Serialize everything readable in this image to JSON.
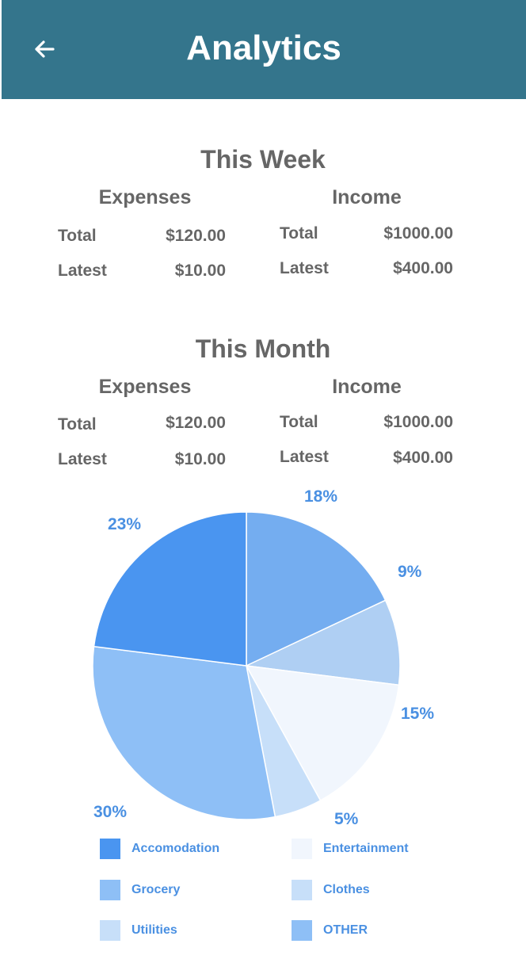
{
  "header": {
    "title": "Analytics",
    "back_icon": "arrow-left-icon"
  },
  "week": {
    "title": "This Week",
    "expenses": {
      "heading": "Expenses",
      "total_label": "Total",
      "total_value": "$120.00",
      "latest_label": "Latest",
      "latest_value": "$10.00"
    },
    "income": {
      "heading": "Income",
      "total_label": "Total",
      "total_value": "$1000.00",
      "latest_label": "Latest",
      "latest_value": "$400.00"
    }
  },
  "month": {
    "title": "This Month",
    "expenses": {
      "heading": "Expenses",
      "total_label": "Total",
      "total_value": "$120.00",
      "latest_label": "Latest",
      "latest_value": "$10.00"
    },
    "income": {
      "heading": "Income",
      "total_label": "Total",
      "total_value": "$1000.00",
      "latest_label": "Latest",
      "latest_value": "$400.00"
    }
  },
  "chart_data": {
    "type": "pie",
    "slices": [
      {
        "label": "OTHER",
        "value": 18,
        "pct_label": "18%",
        "color": "#74adf0"
      },
      {
        "label": "Clothes",
        "value": 9,
        "pct_label": "9%",
        "color": "#afcff3"
      },
      {
        "label": "Entertainment",
        "value": 15,
        "pct_label": "15%",
        "color": "#f1f6fd"
      },
      {
        "label": "Utilities",
        "value": 5,
        "pct_label": "5%",
        "color": "#c7dff9"
      },
      {
        "label": "Grocery",
        "value": 30,
        "pct_label": "30%",
        "color": "#8ebff6"
      },
      {
        "label": "Accomodation",
        "value": 23,
        "pct_label": "23%",
        "color": "#4a95f0"
      }
    ],
    "legend": [
      {
        "label": "Accomodation",
        "color": "#4a95f0"
      },
      {
        "label": "Entertainment",
        "color": "#f1f6fd"
      },
      {
        "label": "Grocery",
        "color": "#8ebff6"
      },
      {
        "label": "Clothes",
        "color": "#c7dff9"
      },
      {
        "label": "Utilities",
        "color": "#c7dff9"
      },
      {
        "label": "OTHER",
        "color": "#8ebff6"
      }
    ],
    "label_color": "#4a90e2"
  }
}
